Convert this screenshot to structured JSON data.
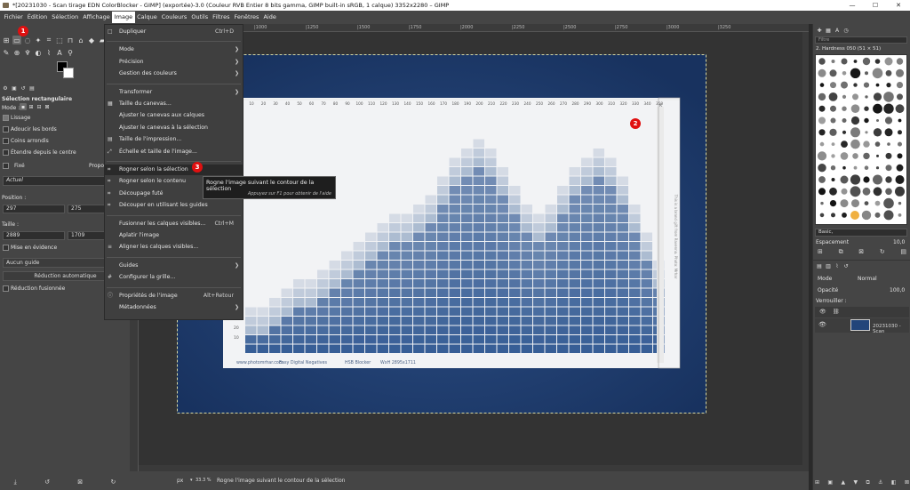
{
  "window": {
    "title": "*[20231030 - Scan tirage EDN ColorBlocker - GIMP] (exportée)-3.0 (Couleur RVB Entier 8 bits gamma, GIMP built-in sRGB, 1 calque) 3352x2280 – GIMP",
    "minimize": "—",
    "maximize": "☐",
    "close": "✕"
  },
  "menubar": [
    "Fichier",
    "Édition",
    "Sélection",
    "Affichage",
    "Image",
    "Calque",
    "Couleurs",
    "Outils",
    "Filtres",
    "Fenêtres",
    "Aide"
  ],
  "image_menu": {
    "items": [
      {
        "label": "Dupliquer",
        "accel": "Ctrl+D",
        "icon": "□"
      },
      {
        "sep": true
      },
      {
        "label": "Mode",
        "submenu": true
      },
      {
        "label": "Précision",
        "submenu": true
      },
      {
        "label": "Gestion des couleurs",
        "submenu": true
      },
      {
        "sep": true
      },
      {
        "label": "Transformer",
        "submenu": true
      },
      {
        "label": "Taille du canevas...",
        "icon": "▦"
      },
      {
        "label": "Ajuster le canevas aux calques"
      },
      {
        "label": "Ajuster le canevas à la sélection"
      },
      {
        "label": "Taille de l'impression...",
        "icon": "▤"
      },
      {
        "label": "Échelle et taille de l'image...",
        "icon": "⤢"
      },
      {
        "sep": true
      },
      {
        "label": "Rogner selon la sélection",
        "icon": "⌗",
        "highlight": true
      },
      {
        "label": "Rogner selon le contenu",
        "icon": "⌗"
      },
      {
        "label": "Découpage futé",
        "icon": "⌗"
      },
      {
        "label": "Découper en utilisant les guides",
        "icon": "⌗"
      },
      {
        "sep": true
      },
      {
        "label": "Fusionner les calques visibles...",
        "accel": "Ctrl+M"
      },
      {
        "label": "Aplatir l'image"
      },
      {
        "label": "Aligner les calques visibles...",
        "icon": "≡"
      },
      {
        "sep": true
      },
      {
        "label": "Guides",
        "submenu": true
      },
      {
        "label": "Configurer la grille...",
        "icon": "#"
      },
      {
        "sep": true
      },
      {
        "label": "Propriétés de l'image",
        "accel": "Alt+Retour",
        "icon": "ⓘ"
      },
      {
        "label": "Métadonnées",
        "submenu": true
      }
    ]
  },
  "tooltip": {
    "title": "Rogne l'image suivant le contour de la sélection",
    "hint": "Appuyez sur F1 pour obtenir de l'aide"
  },
  "badges": [
    "1",
    "2",
    "3"
  ],
  "tool_options": {
    "title": "Sélection rectangulaire",
    "mode_label": "Mode :",
    "antialias": "Lissage",
    "feather": "Adoucir les bords",
    "rounded": "Coins arrondis",
    "expand_center": "Étendre depuis le centre",
    "fixed_label": "Fixé",
    "fixed_value": "Propo",
    "fixed_current": "Actuel",
    "position_label": "Position :",
    "pos_x": "297",
    "pos_y": "275",
    "size_label": "Taille :",
    "size_w": "2889",
    "size_h": "1709",
    "highlight": "Mise en évidence",
    "guides": "Aucun guide",
    "auto_shrink": "Réduction automatique",
    "shrink_merged": "Réduction fusionnée"
  },
  "ruler_ticks": [
    "|500",
    "|750",
    "|1000",
    "|1250",
    "|1500",
    "|1750",
    "|2000",
    "|2250",
    "|2500",
    "|2750",
    "|3000",
    "|3250"
  ],
  "strip": {
    "scale": [
      "10",
      "20",
      "30",
      "40",
      "50",
      "60",
      "70",
      "80",
      "90",
      "100",
      "110",
      "120",
      "130",
      "140",
      "150",
      "160",
      "170",
      "180",
      "190",
      "200",
      "210",
      "220",
      "230",
      "240",
      "250",
      "260",
      "270",
      "280",
      "290",
      "300",
      "310",
      "320",
      "330",
      "340",
      "350"
    ],
    "bottom_text": [
      "www.photomrhar.com",
      "Easy Digital Negatives",
      "HSB Blocker",
      "WxH 2895x1711"
    ],
    "side_text": "This is a brand gift from Ravenna. Photo: Mrhar",
    "left_numbers": [
      "40",
      "30",
      "20",
      "10"
    ],
    "corner_letter": "K"
  },
  "status": {
    "unit": "px",
    "zoom": "33.3 %",
    "message": "Rogne l'image suivant le contour de la sélection"
  },
  "brushes": {
    "filter": "Filtre",
    "current": "2. Hardness 050 (51 × 51)",
    "preset": "Basic,",
    "spacing_label": "Espacement",
    "spacing_value": "10,0"
  },
  "layers": {
    "mode_label": "Mode",
    "mode_value": "Normal",
    "opacity_label": "Opacité",
    "opacity_value": "100,0",
    "lock_label": "Verrouiller :",
    "layer_name": "20231030 - Scan"
  },
  "colors": {
    "accent_red": "#e01010",
    "photo_blue": "#1d3a6a",
    "grid_blue": "#2c5590"
  }
}
